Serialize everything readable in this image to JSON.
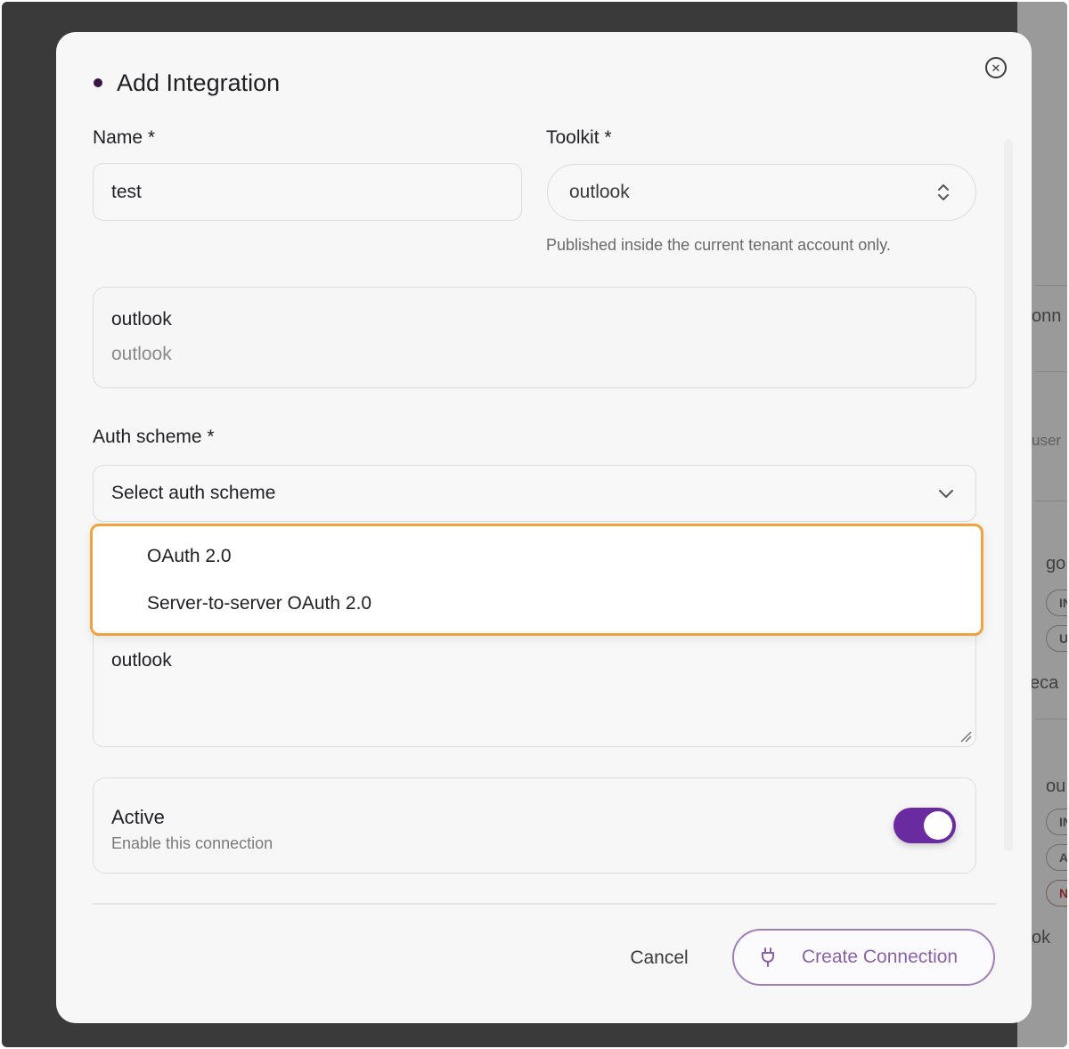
{
  "background": {
    "fragments": [
      "onn",
      "user",
      "go",
      "eca",
      "ou",
      "ok"
    ],
    "pills": [
      "IN",
      "U",
      "IN",
      "A",
      "N"
    ]
  },
  "modal": {
    "title": "Add Integration",
    "close_icon": "x-circle-icon",
    "name_label": "Name *",
    "name_value": "test",
    "toolkit_label": "Toolkit *",
    "toolkit_value": "outlook",
    "toolkit_helper": "Published inside the current tenant account only.",
    "toolkit_card": {
      "primary": "outlook",
      "secondary": "outlook"
    },
    "auth_label": "Auth scheme *",
    "auth_placeholder": "Select auth scheme",
    "auth_options": [
      "OAuth 2.0",
      "Server-to-server OAuth 2.0"
    ],
    "description_value": "outlook",
    "active": {
      "title": "Active",
      "subtitle": "Enable this connection",
      "enabled": true
    },
    "cancel_label": "Cancel",
    "create_label": "Create Connection"
  },
  "colors": {
    "accent": "#6a2aa0",
    "highlight": "#f0a23c",
    "create_text": "#8a62a8"
  }
}
